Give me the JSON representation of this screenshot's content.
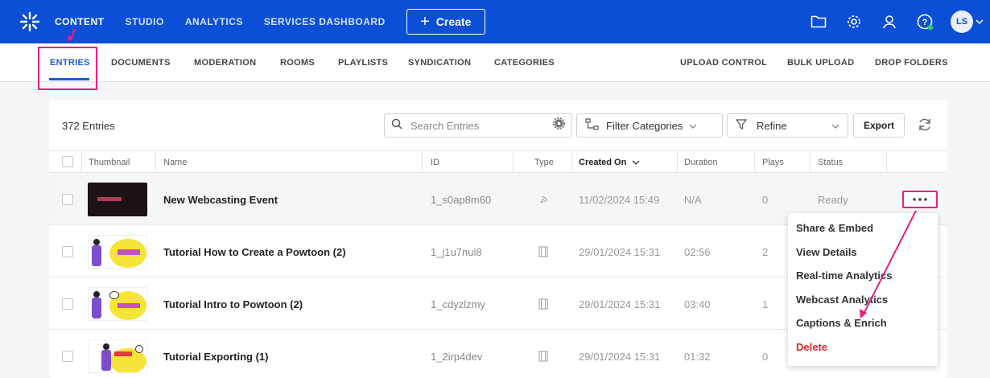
{
  "topnav": {
    "links": [
      "CONTENT",
      "STUDIO",
      "ANALYTICS",
      "SERVICES DASHBOARD"
    ],
    "create_label": "Create",
    "avatar_initials": "LS"
  },
  "subnav": {
    "left": [
      "ENTRIES",
      "DOCUMENTS",
      "MODERATION",
      "ROOMS",
      "PLAYLISTS",
      "SYNDICATION",
      "CATEGORIES"
    ],
    "right": [
      "UPLOAD CONTROL",
      "BULK UPLOAD",
      "DROP FOLDERS"
    ]
  },
  "toolbar": {
    "entries_count": "372 Entries",
    "search_placeholder": "Search Entries",
    "filter_categories": "Filter Categories",
    "refine": "Refine",
    "export": "Export"
  },
  "table": {
    "headers": [
      "Thumbnail",
      "Name",
      "ID",
      "Type",
      "Created On",
      "Duration",
      "Plays",
      "Status"
    ],
    "rows": [
      {
        "name": "New Webcasting Event",
        "id": "1_s0ap8m60",
        "type": "webcast",
        "created": "11/02/2024 15:49",
        "duration": "N/A",
        "plays": "0",
        "status": "Ready"
      },
      {
        "name": "Tutorial How to Create a Powtoon (2)",
        "id": "1_j1u7nui8",
        "type": "video",
        "created": "29/01/2024 15:31",
        "duration": "02:56",
        "plays": "2",
        "status": ""
      },
      {
        "name": "Tutorial Intro to Powtoon (2)",
        "id": "1_cdyzlzmy",
        "type": "video",
        "created": "29/01/2024 15:31",
        "duration": "03:40",
        "plays": "1",
        "status": ""
      },
      {
        "name": "Tutorial Exporting (1)",
        "id": "1_2irp4dev",
        "type": "video",
        "created": "29/01/2024 15:31",
        "duration": "01:32",
        "plays": "0",
        "status": ""
      }
    ]
  },
  "menu": {
    "items": [
      "Share & Embed",
      "View Details",
      "Real-time Analytics",
      "Webcast Analytics",
      "Captions & Enrich",
      "Delete"
    ]
  },
  "colors": {
    "brand": "#0a4fd6",
    "accent": "#1a5ed8",
    "annotation": "#e6217f",
    "danger": "#d8262b"
  }
}
